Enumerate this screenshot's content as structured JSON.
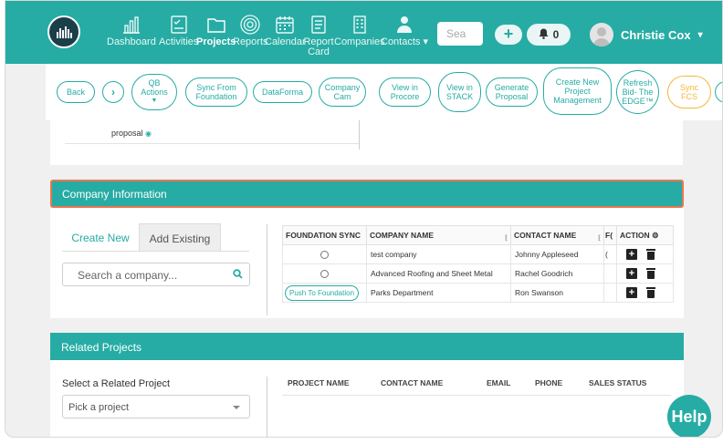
{
  "nav": {
    "items": [
      {
        "label": "Dashboard"
      },
      {
        "label": "Activities"
      },
      {
        "label": "Projects"
      },
      {
        "label": "Reports"
      },
      {
        "label": "Calendar"
      },
      {
        "label": "Report Card"
      },
      {
        "label": "Companies"
      },
      {
        "label": "Contacts"
      }
    ],
    "active": "Projects",
    "search_placeholder": "Sea",
    "notification_count": "0",
    "user_name": "Christie Cox"
  },
  "actions": {
    "back": "Back",
    "qb_actions": "QB Actions",
    "sync_from_foundation": "Sync From Foundation",
    "dataforma": "DataForma",
    "company_cam": "Company Cam",
    "view_in_procore": "View in Procore",
    "view_in_stack": "View in STACK",
    "generate_proposal": "Generate Proposal",
    "create_new_project_management": "Create New Project Management",
    "refresh_bid": "Refresh Bid- The EDGE™",
    "sync_fcs": "Sync FCS"
  },
  "upper_card": {
    "proposal_label": "proposal"
  },
  "company": {
    "title": "Company Information",
    "tab_create": "Create New",
    "tab_existing": "Add Existing",
    "search_placeholder": "Search a company...",
    "columns": [
      "FOUNDATION SYNC",
      "COMPANY NAME",
      "CONTACT NAME",
      "F(",
      "ACTION"
    ],
    "rows": [
      {
        "sync": "",
        "company": "test company",
        "contact": "Johnny Appleseed",
        "f": "("
      },
      {
        "sync": "",
        "company": "Advanced Roofing and Sheet Metal",
        "contact": "Rachel Goodrich",
        "f": ""
      },
      {
        "sync": "Push To Foundation",
        "company": "Parks Department",
        "contact": "Ron Swanson",
        "f": ""
      }
    ]
  },
  "related": {
    "title": "Related Projects",
    "select_label": "Select a Related Project",
    "select_value": "Pick a project",
    "columns": [
      "PROJECT NAME",
      "CONTACT NAME",
      "EMAIL",
      "PHONE",
      "SALES STATUS"
    ]
  },
  "help_label": "Help",
  "colors": {
    "primary": "#26aca4",
    "accent_orange": "#f5b73b",
    "focus_border": "#e9764e"
  }
}
